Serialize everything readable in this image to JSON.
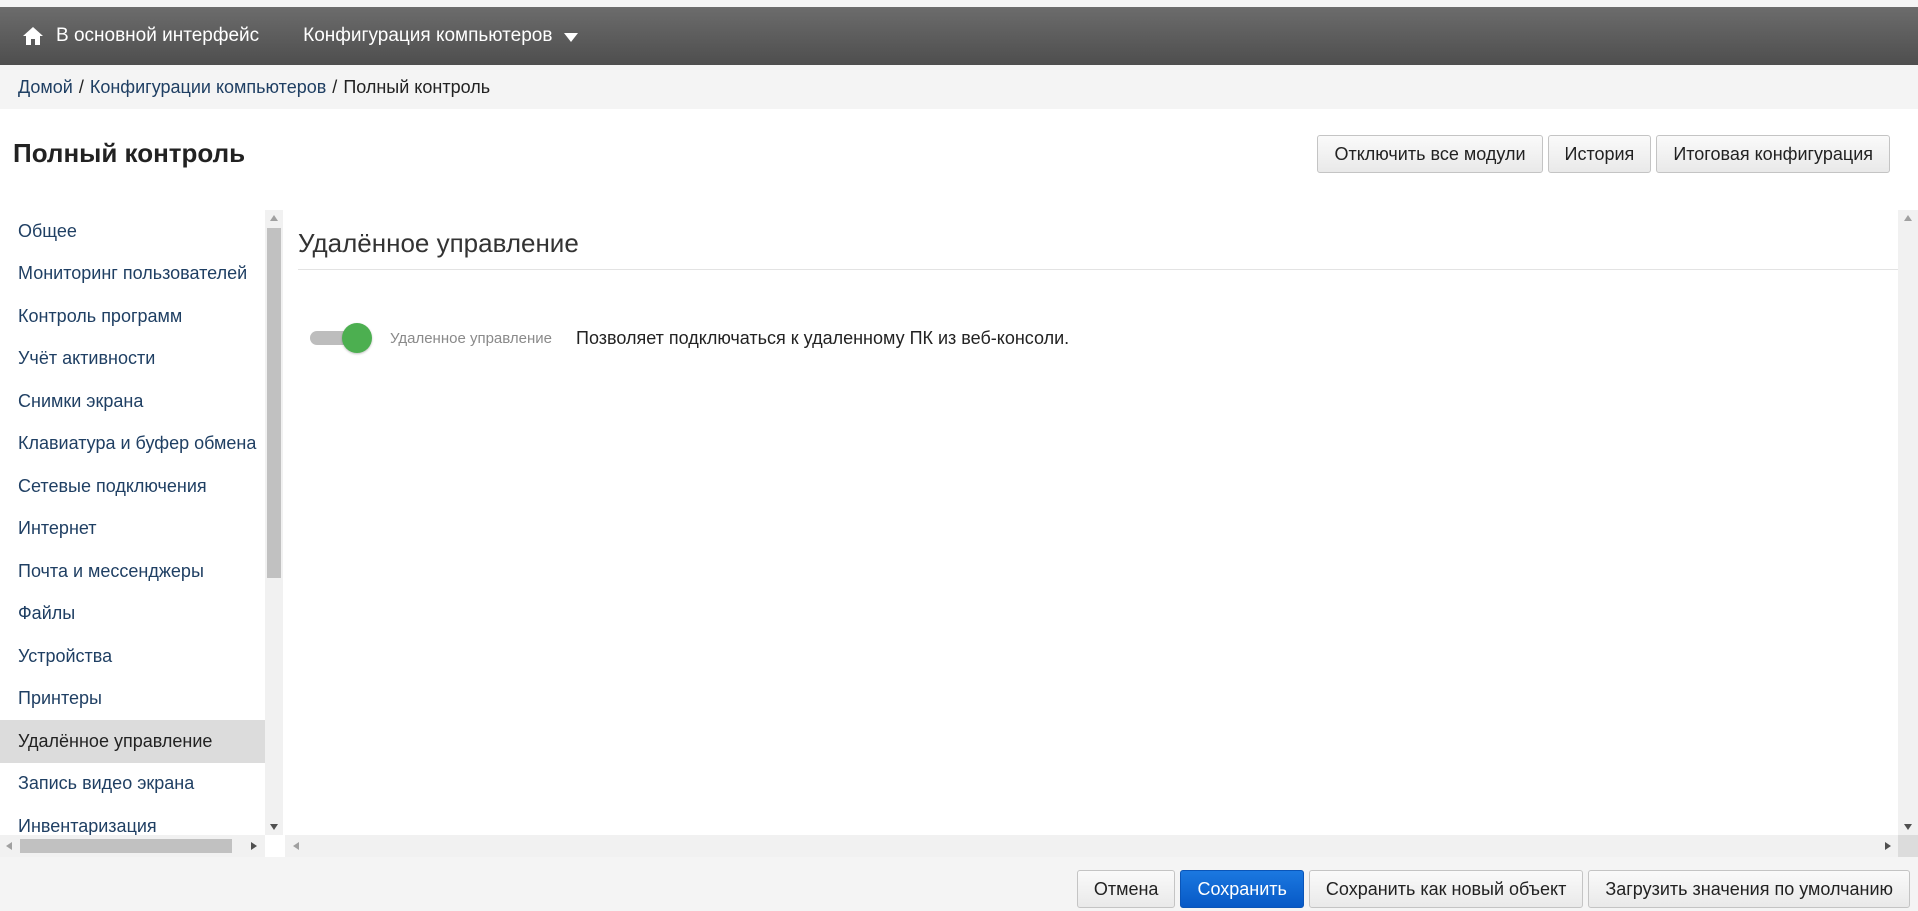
{
  "navbar": {
    "home_label": "В основной интерфейс",
    "config_label": "Конфигурация компьютеров"
  },
  "breadcrumb": {
    "items": [
      "Домой",
      "Конфигурации компьютеров",
      "Полный контроль"
    ]
  },
  "page": {
    "title": "Полный контроль"
  },
  "top_buttons": {
    "disable_all": "Отключить все модули",
    "history": "История",
    "final_config": "Итоговая конфигурация"
  },
  "sidebar": {
    "items": [
      {
        "label": "Общее"
      },
      {
        "label": "Мониторинг пользователей"
      },
      {
        "label": "Контроль программ"
      },
      {
        "label": "Учёт активности"
      },
      {
        "label": "Снимки экрана"
      },
      {
        "label": "Клавиатура и буфер обмена"
      },
      {
        "label": "Сетевые подключения"
      },
      {
        "label": "Интернет"
      },
      {
        "label": "Почта и мессенджеры"
      },
      {
        "label": "Файлы"
      },
      {
        "label": "Устройства"
      },
      {
        "label": "Принтеры"
      },
      {
        "label": "Удалённое управление"
      },
      {
        "label": "Запись видео экрана"
      },
      {
        "label": "Инвентаризация"
      }
    ],
    "active_index": 12
  },
  "content": {
    "section_title": "Удалённое управление",
    "toggle": {
      "label": "Удаленное управление",
      "description": "Позволяет подключаться к удаленному ПК из веб-консоли.",
      "enabled": true,
      "on_color": "#4caf50"
    }
  },
  "bottom_buttons": {
    "cancel": "Отмена",
    "save": "Сохранить",
    "save_as_new": "Сохранить как новый объект",
    "load_defaults": "Загрузить значения по умолчанию"
  },
  "colors": {
    "navbar": "#5a5a5a",
    "link": "#1f3f63",
    "primary_button": "#0d66d0"
  }
}
